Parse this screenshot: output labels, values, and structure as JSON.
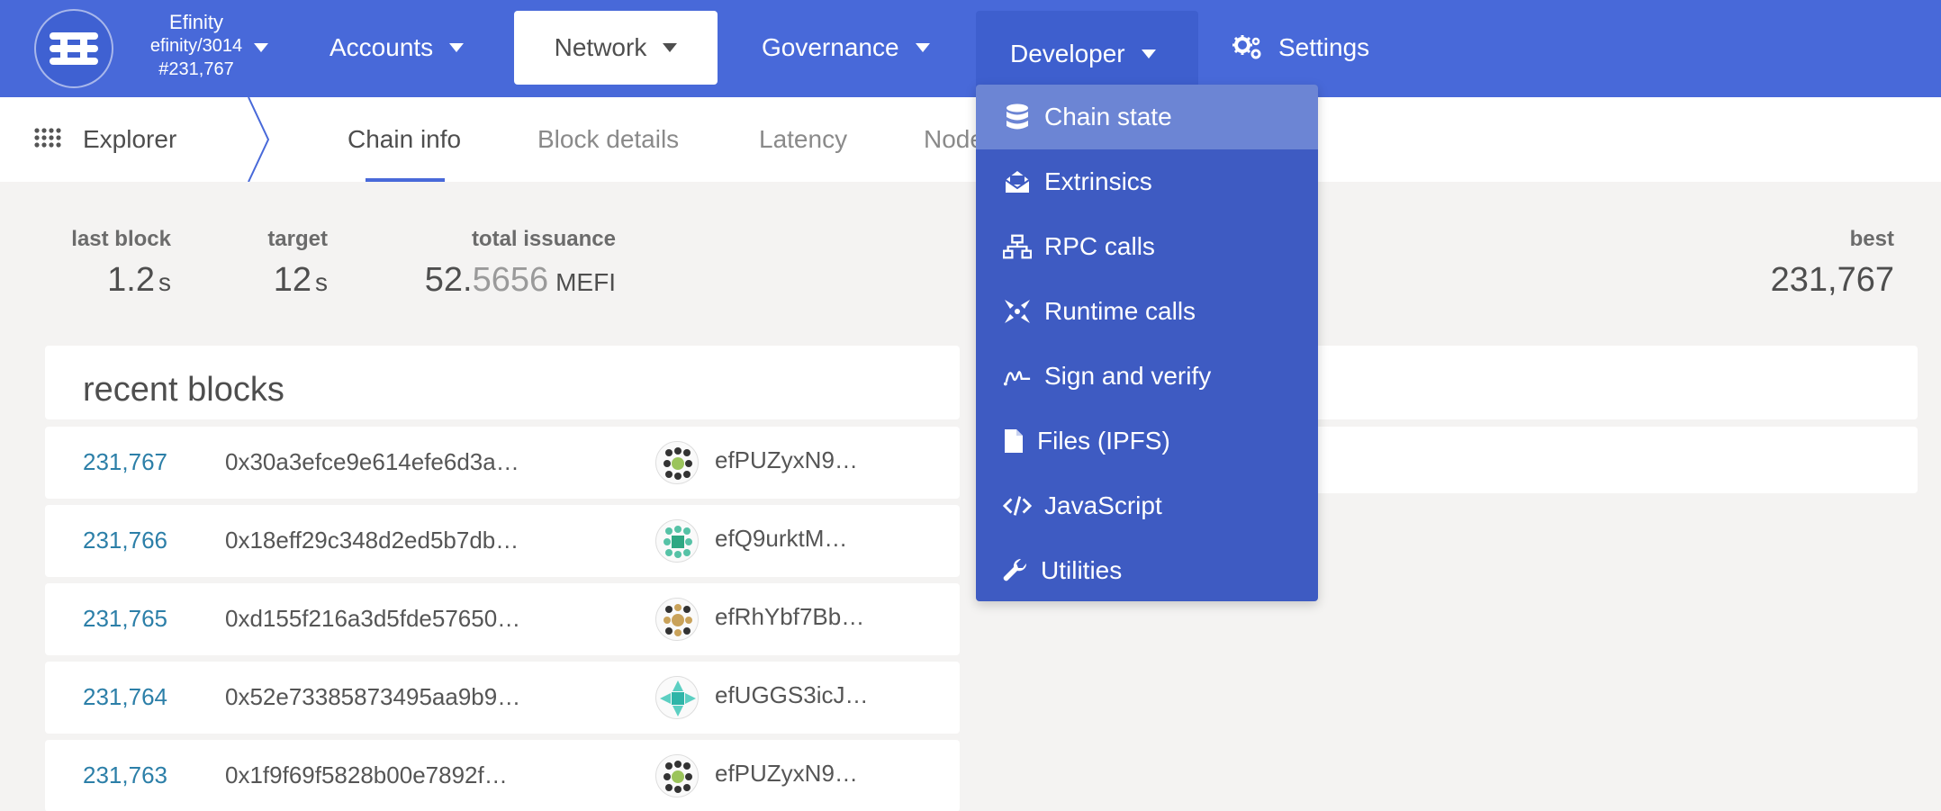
{
  "header": {
    "chain_name": "Efinity",
    "chain_spec": "efinity/3014",
    "block": "#231,767",
    "menus": {
      "accounts": "Accounts",
      "network": "Network",
      "governance": "Governance",
      "developer": "Developer",
      "settings": "Settings"
    }
  },
  "subnav": {
    "explorer": "Explorer",
    "tabs": {
      "chain_info": "Chain info",
      "block_details": "Block details",
      "latency": "Latency",
      "nodes": "Nodes"
    }
  },
  "summary": {
    "last_block": {
      "label": "last block",
      "value": "1.2",
      "unit": "s"
    },
    "target": {
      "label": "target",
      "value": "12",
      "unit": "s"
    },
    "total_issuance": {
      "label": "total issuance",
      "value_main": "52.",
      "value_dim": "5656",
      "unit": "MEFI"
    },
    "best": {
      "label": "best",
      "value": "231,767"
    }
  },
  "recent_blocks": {
    "title": "recent blocks",
    "rows": [
      {
        "number": "231,767",
        "hash": "0x30a3efce9e614efe6d3a…",
        "author": "efPUZyxN9…"
      },
      {
        "number": "231,766",
        "hash": "0x18eff29c348d2ed5b7db…",
        "author": "efQ9urktM…"
      },
      {
        "number": "231,765",
        "hash": "0xd155f216a3d5fde57650…",
        "author": "efRhYbf7Bb…"
      },
      {
        "number": "231,764",
        "hash": "0x52e73385873495aa9b9…",
        "author": "efUGGS3icJ…"
      },
      {
        "number": "231,763",
        "hash": "0x1f9f69f5828b00e7892f…",
        "author": "efPUZyxN9…"
      }
    ]
  },
  "developer_menu": {
    "items": [
      {
        "label": "Chain state",
        "icon": "database-icon"
      },
      {
        "label": "Extrinsics",
        "icon": "envelope-open-icon"
      },
      {
        "label": "RPC calls",
        "icon": "network-icon"
      },
      {
        "label": "Runtime calls",
        "icon": "compress-arrows-icon"
      },
      {
        "label": "Sign and verify",
        "icon": "signature-icon"
      },
      {
        "label": "Files (IPFS)",
        "icon": "file-icon"
      },
      {
        "label": "JavaScript",
        "icon": "code-icon"
      },
      {
        "label": "Utilities",
        "icon": "wrench-icon"
      }
    ]
  },
  "colors": {
    "topbar": "#4869d9",
    "dropdown": "#3e5bc2",
    "dropdown_highlight": "#6c85d4",
    "link": "#2c7fa8",
    "background": "#f4f3f2"
  }
}
